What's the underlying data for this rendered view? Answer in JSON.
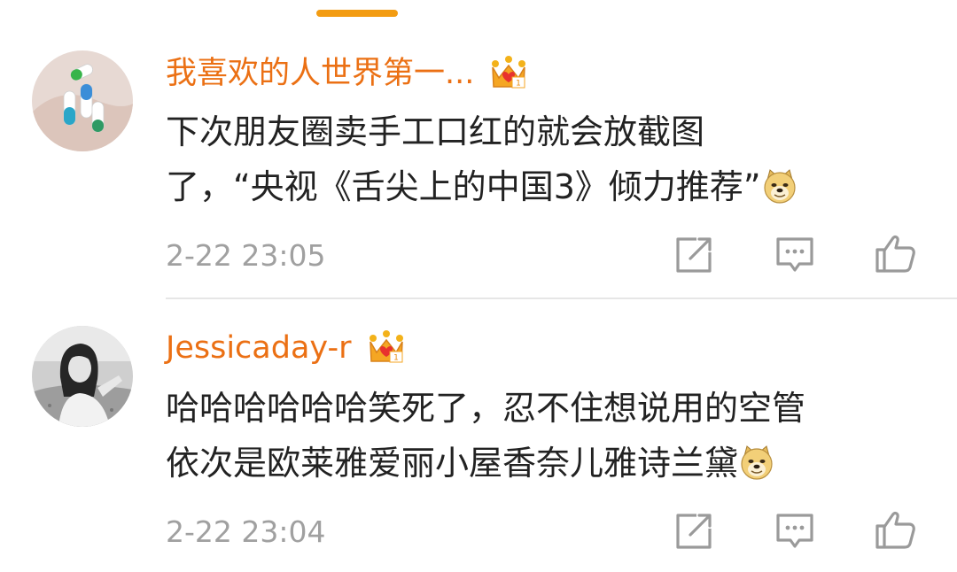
{
  "comments": [
    {
      "username": "我喜欢的人世界第一...",
      "text_lines": [
        "下次朋友圈卖手工口红的就会放截图",
        "了，“央视《舌尖上的中国3》倾力推荐”"
      ],
      "emoji": "doge-emoji",
      "timestamp": "2-22 23:05",
      "avatar": "pills-avatar"
    },
    {
      "username": "Jessicaday-r",
      "text_lines": [
        "哈哈哈哈哈哈笑死了，忍不住想说用的空管",
        "依次是欧莱雅爱丽小屋香奈儿雅诗兰黛"
      ],
      "emoji": "doge-emoji",
      "timestamp": "2-22 23:04",
      "avatar": "girl-avatar"
    }
  ],
  "icons": {
    "badge": "crown-icon",
    "repost": "repost-icon",
    "comment": "comment-icon",
    "like": "thumbs-up-icon"
  },
  "colors": {
    "accent": "#f39c12",
    "username": "#eb7014",
    "timestamp": "#a0a0a0",
    "icon": "#9a9a9a"
  }
}
